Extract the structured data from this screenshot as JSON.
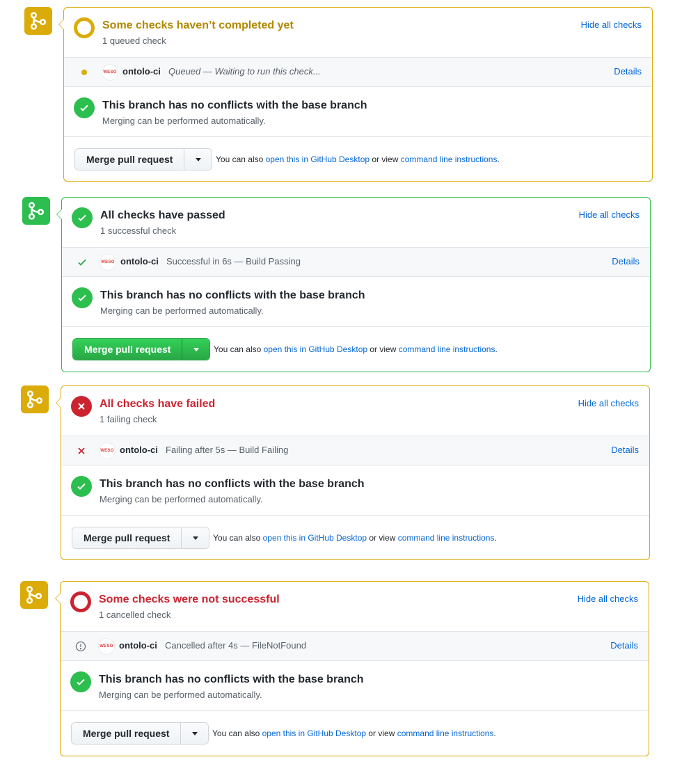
{
  "colors": {
    "pending": "#dbab09",
    "success": "#2cbe4e",
    "failure": "#cb2431",
    "link": "#0366d6"
  },
  "common": {
    "hide_all_checks": "Hide all checks",
    "details": "Details",
    "check_name": "ontolo-ci",
    "avatar_text": "WESO",
    "conflict_title": "This branch has no conflicts with the base branch",
    "conflict_sub": "Merging can be performed automatically.",
    "merge_button": "Merge pull request",
    "note_prefix": "You can also ",
    "note_desktop_link": "open this in GitHub Desktop",
    "note_middle": " or view ",
    "note_cli_link": "command line instructions",
    "note_suffix": "."
  },
  "panels": [
    {
      "state": "pending",
      "title": "Some checks haven’t completed yet",
      "subtitle": "1 queued check",
      "check_description": "Queued — Waiting to run this check...",
      "icons": [
        "git-merge-icon",
        "pending-circle-icon",
        "dot-icon",
        "check-icon",
        "caret-down-icon"
      ]
    },
    {
      "state": "success",
      "title": "All checks have passed",
      "subtitle": "1 successful check",
      "check_description": "Successful in 6s — Build Passing",
      "icons": [
        "git-merge-icon",
        "check-circle-icon",
        "check-icon",
        "check-icon",
        "caret-down-icon"
      ]
    },
    {
      "state": "failure",
      "title": "All checks have failed",
      "subtitle": "1 failing check",
      "check_description": "Failing after 5s — Build Failing",
      "icons": [
        "git-merge-icon",
        "x-circle-icon",
        "x-icon",
        "check-icon",
        "caret-down-icon"
      ]
    },
    {
      "state": "cancelled",
      "title": "Some checks were not successful",
      "subtitle": "1 cancelled check",
      "check_description": "Cancelled after 4s — FileNotFound",
      "icons": [
        "git-merge-icon",
        "ring-circle-icon",
        "alert-circle-icon",
        "check-icon",
        "caret-down-icon"
      ]
    }
  ]
}
